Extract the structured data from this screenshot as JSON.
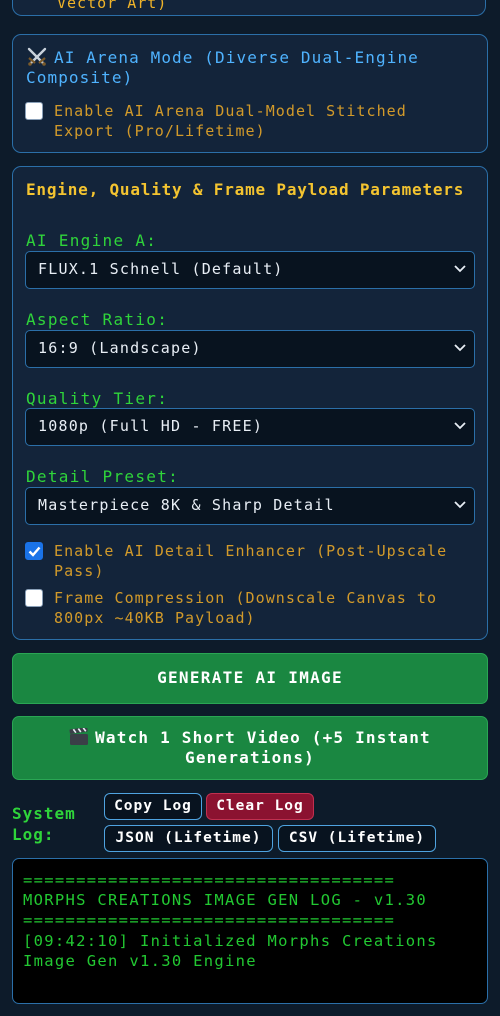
{
  "prev_section": {
    "partial_text": "Vector Art)"
  },
  "arena": {
    "title": "AI Arena Mode (Diverse Dual-Engine Composite)",
    "checkbox_label": "Enable AI Arena Dual-Model Stitched Export (Pro/Lifetime)",
    "checked": false
  },
  "params": {
    "title": "Engine, Quality & Frame Payload Parameters",
    "engine_label": "AI Engine A:",
    "engine_value": "FLUX.1 Schnell (Default)",
    "aspect_label": "Aspect Ratio:",
    "aspect_value": "16:9 (Landscape)",
    "quality_label": "Quality Tier:",
    "quality_value": "1080p (Full HD - FREE)",
    "detail_label": "Detail Preset:",
    "detail_value": "Masterpiece 8K & Sharp Detail",
    "enhancer_label": "Enable AI Detail Enhancer (Post-Upscale Pass)",
    "enhancer_checked": true,
    "compression_label": "Frame Compression (Downscale Canvas to 800px ~40KB Payload)",
    "compression_checked": false
  },
  "buttons": {
    "generate": "GENERATE AI IMAGE",
    "video": "Watch 1 Short Video (+5 Instant Generations)"
  },
  "log": {
    "label": "System Log:",
    "copy": "Copy Log",
    "clear": "Clear Log",
    "json": "JSON (Lifetime)",
    "csv": "CSV (Lifetime)",
    "lines": [
      "===================================",
      "MORPHS CREATIONS IMAGE GEN LOG - v1.30",
      "===================================",
      "[09:42:10] Initialized Morphs Creations",
      "Image Gen v1.30 Engine"
    ]
  },
  "colors": {
    "background": "#0d1b2a",
    "accent_blue": "#4fb3ff",
    "label_green": "#2fd43a",
    "title_yellow": "#f4c430",
    "button_green": "#1a8741",
    "clear_red": "#8b1230"
  }
}
